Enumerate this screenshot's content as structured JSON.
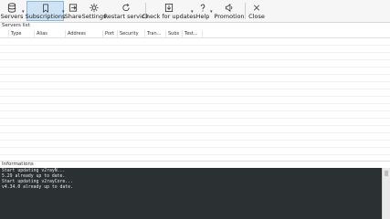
{
  "toolbar": {
    "servers": "Servers",
    "subscriptions": "Subscriptions",
    "share": "Share",
    "settings": "Settings",
    "restart": "Restart service",
    "check_updates": "Check for updates",
    "help": "Help",
    "promotion": "Promotion",
    "close": "Close"
  },
  "icons": {
    "servers": "database-icon",
    "subscriptions": "bookmark-icon",
    "share": "share-icon",
    "settings": "gear-icon",
    "restart": "refresh-icon",
    "check_updates": "download-icon",
    "help": "question-icon",
    "promotion": "speaker-icon",
    "close": "close-icon"
  },
  "servers_list": {
    "label": "Servers list",
    "columns": [
      "Type",
      "Alias",
      "Address",
      "Port",
      "Security",
      "Tran...",
      "Subs",
      "Test..."
    ]
  },
  "info": {
    "label": "Informations",
    "lines": [
      "Start updating v2rayN...",
      "5.29 already up to date.",
      "Start updating v2rayCore...",
      "v4.34.0 already up to date."
    ]
  },
  "colors": {
    "console_bg": "#2b3033",
    "active_tab": "#cfe3f7"
  }
}
